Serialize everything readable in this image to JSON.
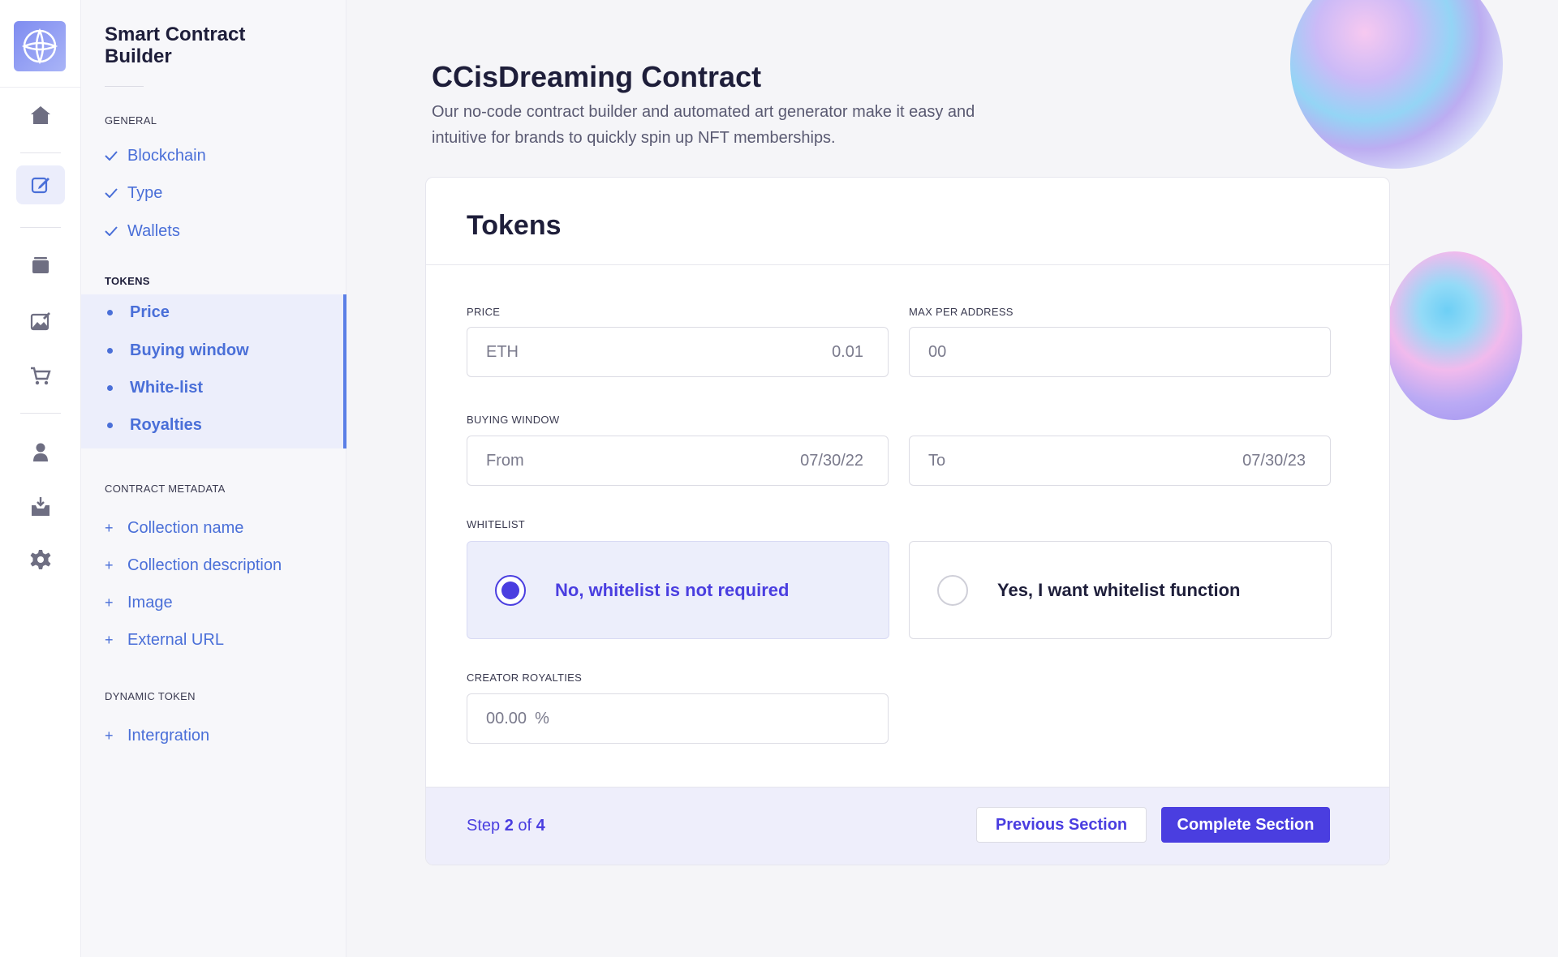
{
  "sidebar_rail": {
    "items": [
      "home-icon",
      "edit-icon",
      "layers-icon",
      "gallery-icon",
      "cart-icon",
      "user-icon",
      "inbox-download-icon",
      "gear-icon"
    ],
    "active": "edit-icon"
  },
  "steps": {
    "title": "Smart Contract Builder",
    "general": {
      "heading": "GENERAL",
      "items": [
        "Blockchain",
        "Type",
        "Wallets"
      ]
    },
    "tokens": {
      "heading": "TOKENS",
      "items": [
        "Price",
        "Buying window",
        "White-list",
        "Royalties"
      ]
    },
    "metadata": {
      "heading": "CONTRACT METADATA",
      "items": [
        "Collection name",
        "Collection description",
        "Image",
        "External URL"
      ]
    },
    "dynamic": {
      "heading": "DYNAMIC TOKEN",
      "items": [
        "Intergration"
      ]
    }
  },
  "page": {
    "title": "CCisDreaming Contract",
    "description": "Our no-code contract builder and automated art generator make it easy and intuitive for brands to quickly spin up NFT memberships."
  },
  "card": {
    "title": "Tokens",
    "price": {
      "label": "PRICE",
      "prefix": "ETH",
      "value": "0.01"
    },
    "max_per_address": {
      "label": "MAX PER ADDRESS",
      "placeholder": "00"
    },
    "buying_window": {
      "label": "BUYING WINDOW",
      "from_label": "From",
      "from_value": "07/30/22",
      "to_label": "To",
      "to_value": "07/30/23"
    },
    "whitelist": {
      "label": "WHITELIST",
      "option_no": "No, whitelist is not required",
      "option_yes": "Yes, I want whitelist function",
      "selected": "no"
    },
    "royalties": {
      "label": "CREATOR ROYALTIES",
      "placeholder": "00.00",
      "unit": "%"
    }
  },
  "footer": {
    "step_word": "Step",
    "step_current": "2",
    "step_of": "of",
    "step_total": "4",
    "prev_label": "Previous Section",
    "next_label": "Complete Section"
  },
  "colors": {
    "accent": "#4a3ee0",
    "link": "#4a6fd8",
    "active_bg": "#eceefb"
  }
}
